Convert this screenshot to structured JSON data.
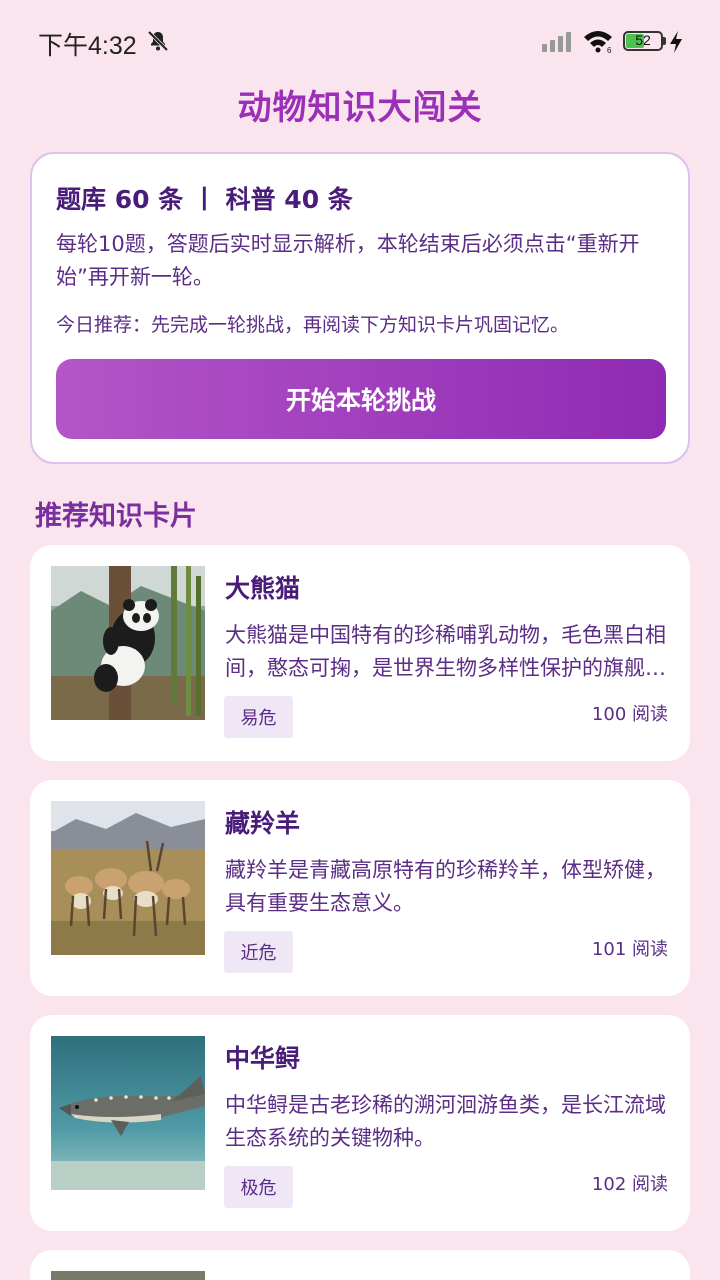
{
  "status_bar": {
    "time": "下午4:32",
    "battery": "52",
    "icons": [
      "bell-off-icon",
      "signal-icon",
      "wifi-icon",
      "battery-icon",
      "charging-icon"
    ]
  },
  "page": {
    "title": "动物知识大闯关"
  },
  "intro": {
    "stats": "题库 60 条 丨 科普 40 条",
    "description": "每轮10题，答题后实时显示解析，本轮结束后必须点击“重新开始”再开新一轮。",
    "tip": "今日推荐：先完成一轮挑战，再阅读下方知识卡片巩固记忆。",
    "start_button": "开始本轮挑战"
  },
  "section": {
    "title": "推荐知识卡片"
  },
  "cards": [
    {
      "title": "大熊猫",
      "description": "大熊猫是中国特有的珍稀哺乳动物，毛色黑白相间，憨态可掬，是世界生物多样性保护的旗舰物种。",
      "tag": "易危",
      "reads": "100 阅读"
    },
    {
      "title": "藏羚羊",
      "description": "藏羚羊是青藏高原特有的珍稀羚羊，体型矫健，具有重要生态意义。",
      "tag": "近危",
      "reads": "101 阅读"
    },
    {
      "title": "中华鲟",
      "description": "中华鲟是古老珍稀的溯河洄游鱼类，是长江流域生态系统的关键物种。",
      "tag": "极危",
      "reads": "102 阅读"
    }
  ],
  "colors": {
    "background": "#fae4ee",
    "accent": "#9b2fb8",
    "text": "#4a1c7a"
  }
}
